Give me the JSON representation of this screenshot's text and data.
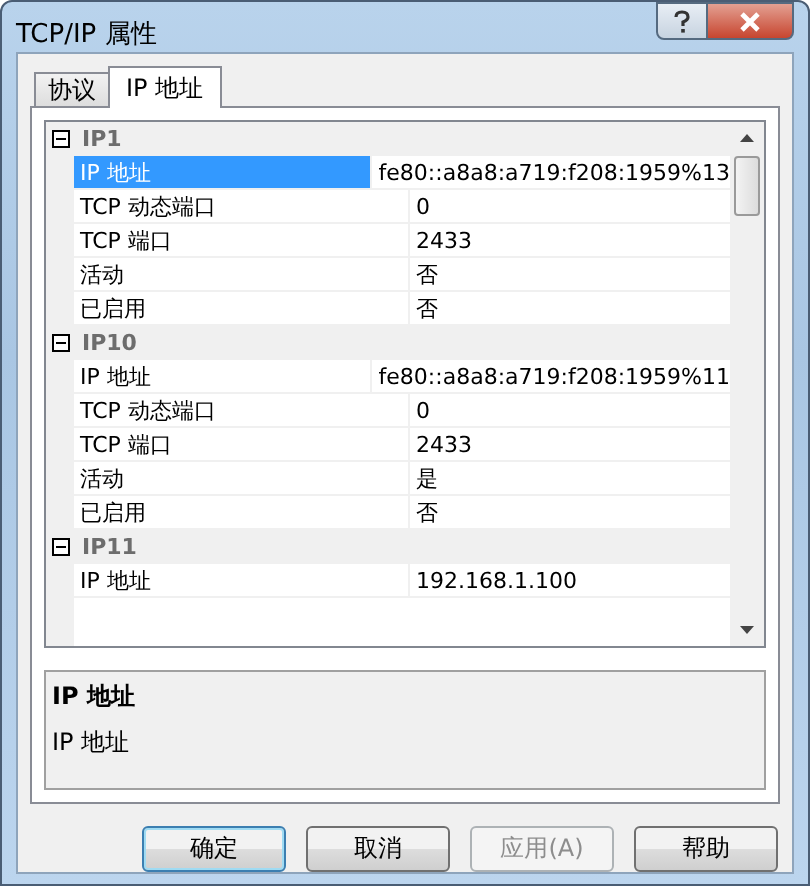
{
  "window": {
    "title": "TCP/IP 属性"
  },
  "tabs": [
    {
      "label": "协议",
      "selected": false
    },
    {
      "label": "IP 地址",
      "selected": true
    }
  ],
  "groups": [
    {
      "name": "IP1",
      "expanded": true,
      "properties": [
        {
          "name": "IP 地址",
          "value": "fe80::a8a8:a719:f208:1959%13",
          "selected": true
        },
        {
          "name": "TCP 动态端口",
          "value": "0",
          "selected": false
        },
        {
          "name": "TCP 端口",
          "value": "2433",
          "selected": false
        },
        {
          "name": "活动",
          "value": "否",
          "selected": false
        },
        {
          "name": "已启用",
          "value": "否",
          "selected": false
        }
      ]
    },
    {
      "name": "IP10",
      "expanded": true,
      "properties": [
        {
          "name": "IP 地址",
          "value": "fe80::a8a8:a719:f208:1959%11",
          "selected": false
        },
        {
          "name": "TCP 动态端口",
          "value": "0",
          "selected": false
        },
        {
          "name": "TCP 端口",
          "value": "2433",
          "selected": false
        },
        {
          "name": "活动",
          "value": "是",
          "selected": false
        },
        {
          "name": "已启用",
          "value": "否",
          "selected": false
        }
      ]
    },
    {
      "name": "IP11",
      "expanded": true,
      "properties": [
        {
          "name": "IP 地址",
          "value": "192.168.1.100",
          "selected": false
        }
      ]
    }
  ],
  "description": {
    "title": "IP 地址",
    "text": "IP 地址"
  },
  "buttons": [
    {
      "label": "确定",
      "default": true,
      "disabled": false
    },
    {
      "label": "取消",
      "default": false,
      "disabled": false
    },
    {
      "label": "应用(A)",
      "default": false,
      "disabled": true
    },
    {
      "label": "帮助",
      "default": false,
      "disabled": false
    }
  ]
}
